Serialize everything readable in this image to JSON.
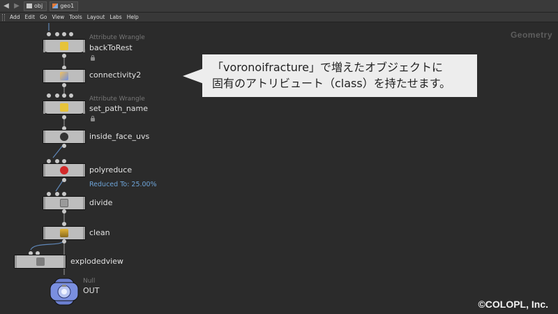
{
  "pathbar": {
    "back": "◀",
    "forward": "▶",
    "crumbs": [
      "obj",
      "geo1"
    ]
  },
  "menu": [
    "Add",
    "Edit",
    "Go",
    "View",
    "Tools",
    "Layout",
    "Labs",
    "Help"
  ],
  "network_context": "Geometry",
  "nodes": [
    {
      "name": "backToRest",
      "type": "Attribute Wrangle",
      "icon": "wrangle-icon",
      "locked": true
    },
    {
      "name": "connectivity2",
      "type": "",
      "icon": "connectivity-icon"
    },
    {
      "name": "set_path_name",
      "type": "Attribute Wrangle",
      "icon": "wrangle-icon",
      "locked": true
    },
    {
      "name": "inside_face_uvs",
      "type": "",
      "icon": "uv-icon"
    },
    {
      "name": "polyreduce",
      "type": "",
      "icon": "polyreduce-icon",
      "info": "Reduced To: 25.00%"
    },
    {
      "name": "divide",
      "type": "",
      "icon": "divide-icon"
    },
    {
      "name": "clean",
      "type": "",
      "icon": "clean-icon"
    },
    {
      "name": "explodedview",
      "type": "",
      "icon": "explodedview-icon"
    },
    {
      "name": "OUT",
      "type": "Null",
      "icon": "null-icon"
    }
  ],
  "callout": {
    "line1": "「voronoifracture」で増えたオブジェクトに",
    "line2": "固有のアトリビュート（class）を持たせます。"
  },
  "copyright": "©COLOPL, Inc.",
  "colors": {
    "info": "#6ea4d8",
    "node_body": "#bdbdbd",
    "background": "#2b2b2b"
  }
}
